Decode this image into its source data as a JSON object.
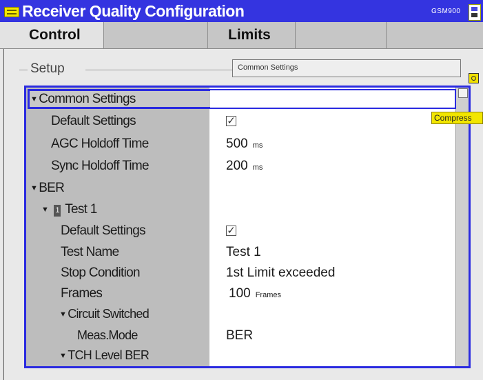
{
  "window": {
    "title": "Receiver Quality Configuration",
    "network": "GSM900"
  },
  "tabs": [
    {
      "label": "Control"
    },
    {
      "label": "Limits"
    }
  ],
  "setup": {
    "label": "Setup",
    "current_section": "Common Settings",
    "compress_tooltip": "Compress"
  },
  "tree": {
    "common": {
      "label": "Common Settings",
      "default_settings": {
        "label": "Default Settings",
        "checked": true
      },
      "agc_holdoff": {
        "label": "AGC Holdoff Time",
        "value": "500",
        "unit": "ms"
      },
      "sync_holdoff": {
        "label": "Sync Holdoff Time",
        "value": "200",
        "unit": "ms"
      }
    },
    "ber": {
      "label": "BER",
      "test": {
        "number": "1",
        "label": "Test 1",
        "default_settings": {
          "label": "Default Settings",
          "checked": true
        },
        "test_name": {
          "label": "Test Name",
          "value": "Test 1"
        },
        "stop_condition": {
          "label": "Stop Condition",
          "value": "1st Limit exceeded"
        },
        "frames": {
          "label": "Frames",
          "value": "100",
          "unit": "Frames"
        },
        "circuit_switched": {
          "label": "Circuit Switched",
          "meas_mode": {
            "label": "Meas.Mode",
            "value": "BER"
          },
          "tch_level_ber": {
            "label": "TCH Level BER"
          }
        }
      }
    }
  },
  "colors": {
    "titlebar": "#3434e0",
    "selection": "#2a2ae0",
    "tooltip": "#f2e600"
  }
}
